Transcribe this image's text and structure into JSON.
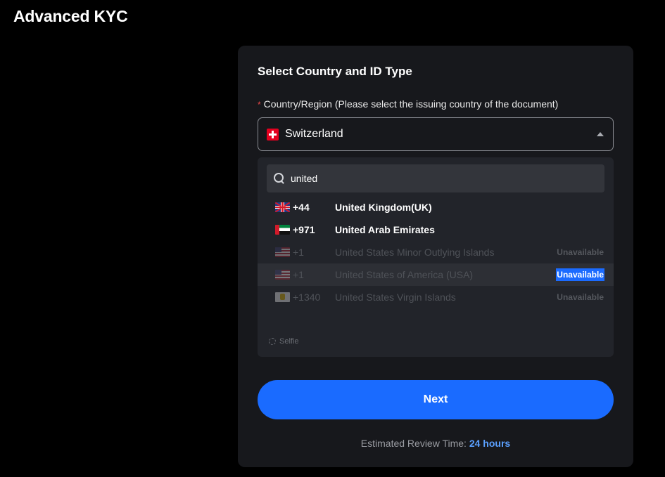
{
  "page": {
    "title": "Advanced KYC"
  },
  "card": {
    "title": "Select Country and ID Type",
    "country_field": {
      "required_mark": "*",
      "label": "Country/Region (Please select the issuing country of the document)",
      "selected_value": "Switzerland",
      "selected_flag": "flag-switzerland-icon"
    },
    "dropdown": {
      "search_value": "united",
      "options": [
        {
          "code": "+44",
          "name": "United Kingdom(UK)",
          "flag": "flag-uk-icon",
          "status": "",
          "disabled": false
        },
        {
          "code": "+971",
          "name": "United Arab Emirates",
          "flag": "flag-uae-icon",
          "status": "",
          "disabled": false
        },
        {
          "code": "+1",
          "name": "United States Minor Outlying Islands",
          "flag": "flag-us-icon",
          "status": "Unavailable",
          "disabled": true
        },
        {
          "code": "+1",
          "name": "United States of America (USA)",
          "flag": "flag-us-icon",
          "status": "Unavailable",
          "disabled": true
        },
        {
          "code": "+1340",
          "name": "United States Virgin Islands",
          "flag": "flag-vi-icon",
          "status": "Unavailable",
          "disabled": true
        }
      ]
    },
    "selfie_label": "Selfie",
    "next_label": "Next",
    "review": {
      "label": "Estimated Review Time:",
      "value": "24 hours"
    }
  },
  "colors": {
    "accent": "#1a6bff",
    "card_bg": "#17181c",
    "dropdown_bg": "#22242a",
    "required": "#f04848"
  }
}
